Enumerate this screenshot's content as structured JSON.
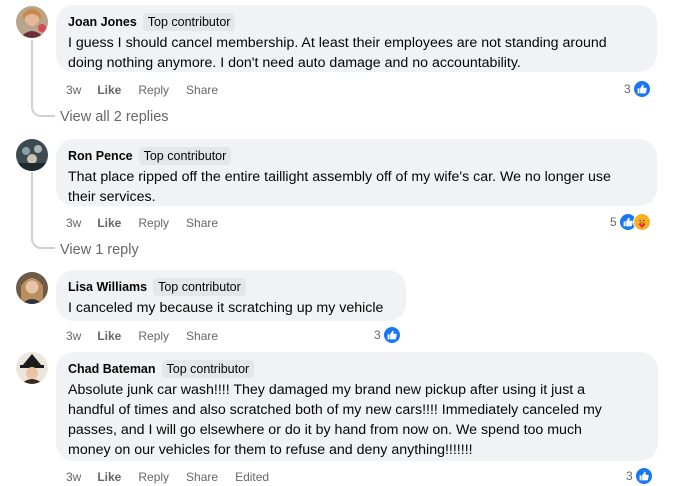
{
  "colors": {
    "bubble": "#f0f2f5",
    "meta_text": "#65676b",
    "like_blue": "#1877f2",
    "care_yellow": "#f7b125"
  },
  "comments": [
    {
      "author": "Joan Jones",
      "badge": "Top contributor",
      "text_lines": [
        "I guess I should cancel membership. At least their employees are not standing around",
        "doing nothing anymore. I don't need auto damage and no accountability."
      ],
      "time": "3w",
      "like": "Like",
      "reply": "Reply",
      "share": "Share",
      "reaction_count": "3",
      "reaction_icons": [
        "like-icon"
      ],
      "view_replies": "View all 2 replies"
    },
    {
      "author": "Ron Pence",
      "badge": "Top contributor",
      "text_lines": [
        "That place ripped off the entire taillight assembly off of my wife's car. We no longer use",
        "their services."
      ],
      "time": "3w",
      "like": "Like",
      "reply": "Reply",
      "share": "Share",
      "reaction_count": "5",
      "reaction_icons": [
        "like-icon",
        "care-icon"
      ],
      "view_replies": "View 1 reply"
    },
    {
      "author": "Lisa Williams",
      "badge": "Top contributor",
      "text_lines": [
        "I canceled my because it scratching up my vehicle"
      ],
      "time": "3w",
      "like": "Like",
      "reply": "Reply",
      "share": "Share",
      "reaction_count": "3",
      "reaction_icons": [
        "like-icon"
      ]
    },
    {
      "author": "Chad Bateman",
      "badge": "Top contributor",
      "text_lines": [
        "Absolute junk car wash!!!! They damaged my brand new pickup after using it just a",
        "handful of times and also scratched both of my new cars!!!! Immediately canceled my",
        "passes, and I will go elsewhere or do it by hand from now on. We spend too much",
        "money on our vehicles for them to refuse and deny anything!!!!!!!"
      ],
      "time": "3w",
      "like": "Like",
      "reply": "Reply",
      "share": "Share",
      "edited": "Edited",
      "reaction_count": "3",
      "reaction_icons": [
        "like-icon"
      ]
    }
  ]
}
